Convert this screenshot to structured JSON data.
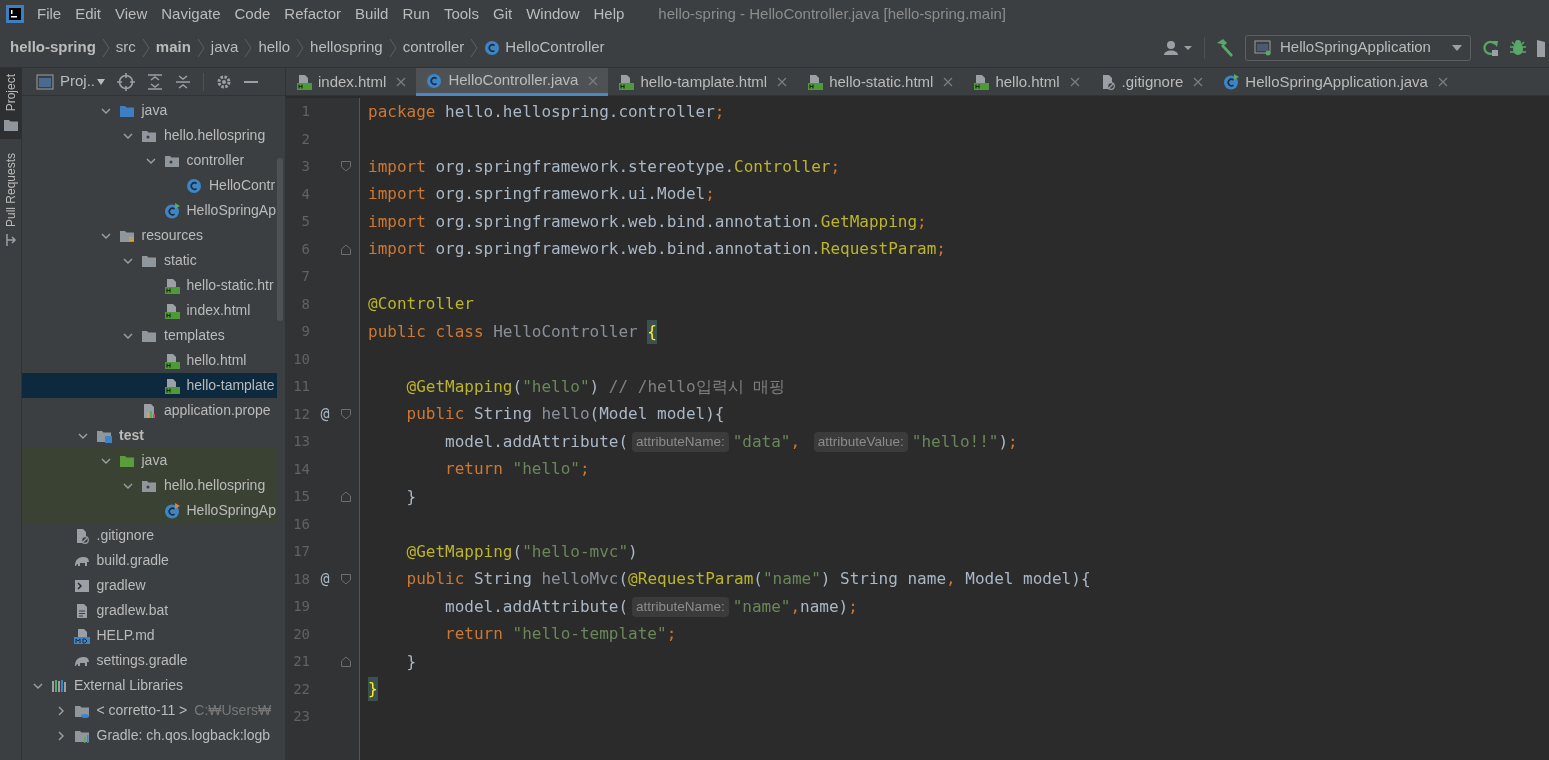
{
  "menu": [
    "File",
    "Edit",
    "View",
    "Navigate",
    "Code",
    "Refactor",
    "Build",
    "Run",
    "Tools",
    "Git",
    "Window",
    "Help"
  ],
  "window_title": "hello-spring - HelloController.java [hello-spring.main]",
  "breadcrumbs": [
    {
      "label": "hello-spring",
      "bold": true
    },
    {
      "label": "src",
      "bold": false
    },
    {
      "label": "main",
      "bold": true
    },
    {
      "label": "java",
      "bold": false
    },
    {
      "label": "hello",
      "bold": false
    },
    {
      "label": "hellospring",
      "bold": false
    },
    {
      "label": "controller",
      "bold": false
    },
    {
      "label": "HelloController",
      "bold": false,
      "kind": "class"
    }
  ],
  "run_config": "HelloSpringApplication",
  "side_tabs": [
    {
      "label": "Project",
      "selected": true,
      "kind": "folder"
    },
    {
      "label": "Pull Requests",
      "selected": false,
      "kind": "pr"
    }
  ],
  "project_panel": {
    "title": "Proj..",
    "tree": [
      {
        "children": [
          {
            "children": [
              {
                "children": [
                  {
                    "label": "java",
                    "kind": "src",
                    "expanded": true,
                    "selected": false,
                    "children": [
                      {
                        "label": "hello.hellospring",
                        "kind": "package",
                        "expanded": true,
                        "selected": false,
                        "children": [
                          {
                            "label": "controller",
                            "kind": "package",
                            "expanded": true,
                            "selected": false,
                            "children": [
                              {
                                "label": "HelloContr",
                                "kind": "class",
                                "selected": false
                              }
                            ]
                          },
                          {
                            "label": "HelloSpringAp",
                            "kind": "app",
                            "selected": false
                          }
                        ]
                      }
                    ]
                  },
                  {
                    "label": "resources",
                    "kind": "resources",
                    "expanded": true,
                    "selected": false,
                    "children": [
                      {
                        "label": "static",
                        "kind": "folder",
                        "expanded": true,
                        "selected": false,
                        "children": [
                          {
                            "label": "hello-static.htr",
                            "kind": "html",
                            "selected": false
                          },
                          {
                            "label": "index.html",
                            "kind": "html",
                            "selected": false
                          }
                        ]
                      },
                      {
                        "label": "templates",
                        "kind": "folder",
                        "expanded": true,
                        "selected": false,
                        "children": [
                          {
                            "label": "hello.html",
                            "kind": "html",
                            "selected": false
                          },
                          {
                            "label": "hello-tamplate",
                            "kind": "html",
                            "selected": true
                          }
                        ]
                      },
                      {
                        "label": "application.prope",
                        "kind": "props",
                        "selected": false
                      }
                    ]
                  }
                ]
              },
              {
                "label": "test",
                "kind": "test",
                "bold": true,
                "expanded": true,
                "selected": false,
                "children": [
                  {
                    "label": "java",
                    "kind": "testsrc",
                    "expanded": true,
                    "selected": false,
                    "highlighted": true,
                    "children": [
                      {
                        "label": "hello.hellospring",
                        "kind": "package",
                        "expanded": true,
                        "selected": false,
                        "highlighted": true,
                        "children": [
                          {
                            "label": "HelloSpringAp",
                            "kind": "testclass",
                            "selected": false,
                            "highlighted": true
                          }
                        ]
                      }
                    ]
                  }
                ]
              }
            ]
          },
          {
            "label": ".gitignore",
            "kind": "ignore",
            "selected": false
          },
          {
            "label": "build.gradle",
            "kind": "gradle",
            "selected": false
          },
          {
            "label": "gradlew",
            "kind": "shell",
            "selected": false
          },
          {
            "label": "gradlew.bat",
            "kind": "text",
            "selected": false
          },
          {
            "label": "HELP.md",
            "kind": "md",
            "selected": false
          },
          {
            "label": "settings.gradle",
            "kind": "gradle",
            "selected": false
          }
        ]
      },
      {
        "label": "External Libraries",
        "kind": "library",
        "expanded": true,
        "selected": false,
        "children": [
          {
            "label": "< corretto-11 >",
            "note": "C:₩Users₩",
            "kind": "jdk",
            "expanded": false,
            "selected": false
          },
          {
            "label": "Gradle: ch.qos.logback:logb",
            "kind": "lib",
            "expanded": false,
            "selected": false
          }
        ]
      }
    ]
  },
  "tabs": [
    {
      "label": "index.html",
      "kind": "html",
      "selected": false
    },
    {
      "label": "HelloController.java",
      "kind": "class",
      "selected": true
    },
    {
      "label": "hello-tamplate.html",
      "kind": "html",
      "selected": false
    },
    {
      "label": "hello-static.html",
      "kind": "html",
      "selected": false
    },
    {
      "label": "hello.html",
      "kind": "html",
      "selected": false
    },
    {
      "label": ".gitignore",
      "kind": "ignore",
      "selected": false
    },
    {
      "label": "HelloSpringApplication.java",
      "kind": "app",
      "selected": false
    }
  ],
  "code": [
    {
      "n": "1",
      "t": [
        {
          "kind": "kw",
          "text": "package "
        },
        {
          "kind": "plain",
          "text": "hello.hellospring.controller"
        },
        {
          "kind": "kw",
          "text": ";"
        }
      ]
    },
    {
      "n": "2"
    },
    {
      "n": "3",
      "kind": "fold-start",
      "t": [
        {
          "kind": "kw",
          "text": "import "
        },
        {
          "kind": "plain",
          "text": "org.springframework.stereotype."
        },
        {
          "kind": "ann",
          "text": "Controller"
        },
        {
          "kind": "kw",
          "text": ";"
        }
      ]
    },
    {
      "n": "4",
      "t": [
        {
          "kind": "kw",
          "text": "import "
        },
        {
          "kind": "plain",
          "text": "org.springframework.ui.Model"
        },
        {
          "kind": "kw",
          "text": ";"
        }
      ]
    },
    {
      "n": "5",
      "t": [
        {
          "kind": "kw",
          "text": "import "
        },
        {
          "kind": "plain",
          "text": "org.springframework.web.bind.annotation."
        },
        {
          "kind": "ann",
          "text": "GetMapping"
        },
        {
          "kind": "kw",
          "text": ";"
        }
      ]
    },
    {
      "n": "6",
      "kind": "fold-end",
      "t": [
        {
          "kind": "kw",
          "text": "import "
        },
        {
          "kind": "plain",
          "text": "org.springframework.web.bind.annotation."
        },
        {
          "kind": "ann",
          "text": "RequestParam"
        },
        {
          "kind": "kw",
          "text": ";"
        }
      ]
    },
    {
      "n": "7"
    },
    {
      "n": "8",
      "t": [
        {
          "kind": "ann",
          "text": "@Controller"
        }
      ]
    },
    {
      "n": "9",
      "t": [
        {
          "kind": "kw",
          "text": "public class "
        },
        {
          "kind": "unused",
          "text": "HelloController "
        },
        {
          "kind": "match",
          "text": "{"
        }
      ]
    },
    {
      "n": "10"
    },
    {
      "n": "11",
      "t": [
        {
          "kind": "ann",
          "text": "    @GetMapping"
        },
        {
          "kind": "plain",
          "text": "("
        },
        {
          "kind": "str",
          "text": "\"hello\""
        },
        {
          "kind": "plain",
          "text": ") "
        },
        {
          "kind": "comment",
          "text": "// /hello입력시 매핑"
        }
      ]
    },
    {
      "n": "12",
      "mark": "@",
      "kind": "fold-start",
      "t": [
        {
          "kind": "kw",
          "text": "    public "
        },
        {
          "kind": "plain",
          "text": "String "
        },
        {
          "kind": "unused",
          "text": "hello"
        },
        {
          "kind": "plain",
          "text": "(Model model){"
        }
      ]
    },
    {
      "n": "13",
      "t": [
        {
          "kind": "plain",
          "text": "        model.addAttribute("
        },
        {
          "kind": "hint",
          "text": "attributeName:"
        },
        {
          "kind": "str",
          "text": "\"data\""
        },
        {
          "kind": "kw",
          "text": ", "
        },
        {
          "kind": "hint",
          "text": "attributeValue:"
        },
        {
          "kind": "str",
          "text": "\"hello!!\""
        },
        {
          "kind": "plain",
          "text": ")"
        },
        {
          "kind": "kw",
          "text": ";"
        }
      ]
    },
    {
      "n": "14",
      "t": [
        {
          "kind": "kw",
          "text": "        return "
        },
        {
          "kind": "str",
          "text": "\"hello\""
        },
        {
          "kind": "kw",
          "text": ";"
        }
      ]
    },
    {
      "n": "15",
      "kind": "fold-end",
      "t": [
        {
          "kind": "plain",
          "text": "    }"
        }
      ]
    },
    {
      "n": "16"
    },
    {
      "n": "17",
      "t": [
        {
          "kind": "ann",
          "text": "    @GetMapping"
        },
        {
          "kind": "plain",
          "text": "("
        },
        {
          "kind": "str",
          "text": "\"hello-mvc\""
        },
        {
          "kind": "plain",
          "text": ")"
        }
      ]
    },
    {
      "n": "18",
      "mark": "@",
      "kind": "fold-start",
      "t": [
        {
          "kind": "kw",
          "text": "    public "
        },
        {
          "kind": "plain",
          "text": "String "
        },
        {
          "kind": "unused",
          "text": "helloMvc"
        },
        {
          "kind": "plain",
          "text": "("
        },
        {
          "kind": "ann",
          "text": "@RequestParam"
        },
        {
          "kind": "plain",
          "text": "("
        },
        {
          "kind": "str",
          "text": "\"name\""
        },
        {
          "kind": "plain",
          "text": ") String name"
        },
        {
          "kind": "kw",
          "text": ", "
        },
        {
          "kind": "plain",
          "text": "Model model){"
        }
      ]
    },
    {
      "n": "19",
      "t": [
        {
          "kind": "plain",
          "text": "        model.addAttribute("
        },
        {
          "kind": "hint",
          "text": "attributeName:"
        },
        {
          "kind": "str",
          "text": "\"name\""
        },
        {
          "kind": "kw",
          "text": ","
        },
        {
          "kind": "plain",
          "text": "name)"
        },
        {
          "kind": "kw",
          "text": ";"
        }
      ]
    },
    {
      "n": "20",
      "t": [
        {
          "kind": "kw",
          "text": "        return "
        },
        {
          "kind": "str",
          "text": "\"hello-template\""
        },
        {
          "kind": "kw",
          "text": ";"
        }
      ]
    },
    {
      "n": "21",
      "kind": "fold-end",
      "t": [
        {
          "kind": "plain",
          "text": "    }"
        }
      ]
    },
    {
      "n": "22",
      "t": [
        {
          "kind": "match",
          "text": "}"
        }
      ]
    },
    {
      "n": "23"
    }
  ]
}
